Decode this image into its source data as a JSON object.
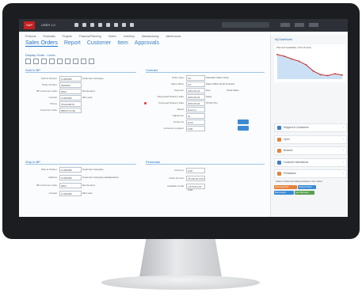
{
  "app": {
    "name": "USER 1.0",
    "logo_text": "SAP"
  },
  "nav": [
    "Products",
    "Financials",
    "Projects",
    "Financial Planning",
    "Orders",
    "Inventory",
    "Manufacturing",
    "Warehouses"
  ],
  "subnav": {
    "tabs": [
      "Sales Orders",
      "Report",
      "Customer",
      "Item",
      "Approvals"
    ],
    "active": "Sales Orders"
  },
  "page_title": "Display Order - Lines",
  "sections": {
    "sold_to": "Sold to BP",
    "contact": "Contract",
    "ship_to": "Ship to BP",
    "financials": "Financials"
  },
  "left_fields": [
    {
      "label": "Sold-to Partner",
      "value": "C1000000",
      "note": "Customer Company"
    },
    {
      "label": "Order Number",
      "value": "0000000"
    },
    {
      "label": "BP Customer Code",
      "value": "6820",
      "note": "Net Amount"
    },
    {
      "label": "Contact",
      "value": "C1000000",
      "note": "HD Level"
    },
    {
      "label": "Phone",
      "value": "7812345678"
    },
    {
      "label": "Customer Code",
      "value": "BBP1073-OE"
    }
  ],
  "right_fields": [
    {
      "label": "Order Type",
      "value": "SO",
      "note": "Standard Sales Order"
    },
    {
      "label": "Sales Office",
      "value": "SO",
      "note": "Sales Office North America"
    },
    {
      "label": "Payment",
      "value": "2003-05-04",
      "note": "Due",
      "extra": "Fixed Value"
    },
    {
      "label": "Requested Delivery Date",
      "value": "2003-05-04",
      "note": "Apply"
    },
    {
      "label": "Proposed Delivery Date",
      "value": "2003-05-04",
      "note": "15:00 UTC"
    },
    {
      "label": "Status",
      "value": "Entered"
    },
    {
      "label": "Salesforce",
      "value": "01"
    },
    {
      "label": "Incoterms",
      "value": "EXW"
    },
    {
      "label": "Incoterms Location",
      "value": "FOB"
    }
  ],
  "ship_fields": [
    {
      "label": "Ship-to Partner",
      "value": "C1000000",
      "note": "Customer Company"
    },
    {
      "label": "Address",
      "value": "C1000000",
      "note": "Customer Company Headquarters"
    },
    {
      "label": "BP Customer Code",
      "value": "6820",
      "note": "Net Amount"
    },
    {
      "label": "Contact",
      "value": "C1000000",
      "note": "HD Level"
    }
  ],
  "fin_fields": [
    {
      "label": "Currency",
      "value": "USD"
    },
    {
      "label": "Order Amount",
      "value": "78,000.00 USD"
    },
    {
      "label": "Available Credit",
      "value": "1,875,011.00 USD"
    }
  ],
  "panel": {
    "title": "My Dashboard",
    "chart_legend": "Planned Availability (This Period)",
    "rows": [
      {
        "label": "Shipped to Customers",
        "icon": "truck-icon",
        "color": "#3b7fc9"
      },
      {
        "label": "Open",
        "icon": "folder-icon",
        "color": "#e5813b"
      },
      {
        "label": "Blocked",
        "icon": "alert-icon",
        "color": "#e5813b"
      },
      {
        "label": "Customer Interactions",
        "icon": "people-icon",
        "color": "#3b7fc9"
      },
      {
        "label": "Predictions",
        "icon": "forecast-icon",
        "color": "#e5813b"
      }
    ],
    "prediction_note": "Tasks to follow forecasting activities in the market",
    "tiles": [
      "Upcoming Risks",
      "Delayed Orders",
      "Risk Analysis",
      "Late Shipments"
    ]
  },
  "chart_data": {
    "type": "line",
    "series": [
      {
        "name": "Planned Availability (This Period)",
        "values": [
          95,
          91,
          85,
          80,
          72,
          58,
          50,
          48,
          52,
          49
        ]
      }
    ],
    "ylim": [
      40,
      100
    ],
    "colors": {
      "line": "#c43030",
      "area": "#6aa7df"
    }
  },
  "colors": {
    "accent": "#1a73c9",
    "brand": "#c41f1f"
  }
}
